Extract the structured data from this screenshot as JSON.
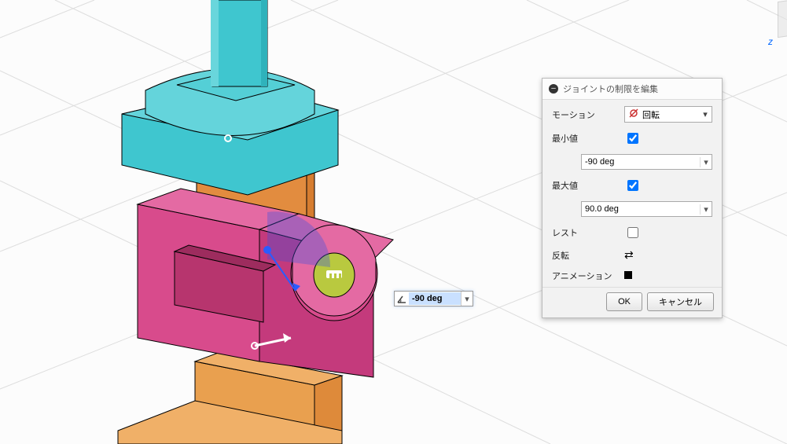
{
  "dialog": {
    "title": "ジョイントの制限を編集",
    "rows": {
      "motion_label": "モーション",
      "motion_value": "回転",
      "min_label": "最小値",
      "min_checked": true,
      "min_value": "-90 deg",
      "max_label": "最大値",
      "max_checked": true,
      "max_value": "90.0 deg",
      "rest_label": "レスト",
      "rest_checked": false,
      "reverse_label": "反転",
      "anim_label": "アニメーション"
    },
    "buttons": {
      "ok": "OK",
      "cancel": "キャンセル"
    }
  },
  "floating_input": {
    "value": "-90 deg"
  },
  "viewcube": {
    "z_axis": "z"
  }
}
